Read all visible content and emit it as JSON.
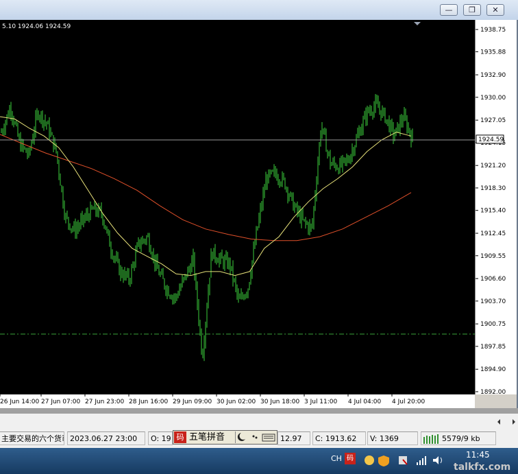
{
  "window": {
    "minimize_glyph": "—",
    "restore_glyph": "❐",
    "close_glyph": "✕"
  },
  "ohlc_text": "5.10 1924.06 1924.59",
  "current_price": "1924.59",
  "price_ticks": [
    "1938.75",
    "1935.88",
    "1932.90",
    "1930.00",
    "1927.05",
    "1924.15",
    "1921.20",
    "1918.30",
    "1915.40",
    "1912.45",
    "1909.55",
    "1906.60",
    "1903.70",
    "1900.75",
    "1897.85",
    "1894.90",
    "1892.00"
  ],
  "time_ticks": [
    "26 Jun 14:00",
    "27 Jun 07:00",
    "27 Jun 23:00",
    "28 Jun 16:00",
    "29 Jun 09:00",
    "30 Jun 02:00",
    "30 Jun 18:00",
    "3 Jul 11:00",
    "4 Jul 04:00",
    "4 Jul 20:00"
  ],
  "chart_data": {
    "type": "candlestick",
    "x_tick_labels": [
      "26 Jun 14:00",
      "27 Jun 07:00",
      "27 Jun 23:00",
      "28 Jun 16:00",
      "29 Jun 09:00",
      "30 Jun 02:00",
      "30 Jun 18:00",
      "3 Jul 11:00",
      "4 Jul 04:00",
      "4 Jul 20:00"
    ],
    "y_tick_labels": [
      "1938.75",
      "1935.88",
      "1932.90",
      "1930.00",
      "1927.05",
      "1924.15",
      "1921.20",
      "1918.30",
      "1915.40",
      "1912.45",
      "1909.55",
      "1906.60",
      "1903.70",
      "1900.75",
      "1897.85",
      "1894.90",
      "1892.00"
    ],
    "ylim": [
      1892.0,
      1938.75
    ],
    "close_path": [
      1925.5,
      1928.8,
      1924.0,
      1922.5,
      1928.2,
      1926.5,
      1923.0,
      1914.5,
      1912.8,
      1914.2,
      1915.5,
      1915.0,
      1910.5,
      1907.5,
      1906.5,
      1911.0,
      1912.0,
      1908.0,
      1905.5,
      1904.0,
      1906.5,
      1909.0,
      1896.5,
      1910.0,
      1909.0,
      1908.5,
      1903.5,
      1905.5,
      1913.0,
      1919.5,
      1920.2,
      1919.0,
      1916.0,
      1914.0,
      1913.0,
      1926.5,
      1921.5,
      1921.0,
      1922.0,
      1925.0,
      1928.0,
      1929.0,
      1927.5,
      1925.0,
      1927.5,
      1924.6
    ],
    "ma_fast": [
      1927.5,
      1927.2,
      1926.0,
      1925.0,
      1923.5,
      1921.0,
      1918.0,
      1915.0,
      1912.5,
      1910.5,
      1909.5,
      1908.5,
      1907.2,
      1907.0,
      1907.5,
      1907.5,
      1907.0,
      1907.5,
      1910.5,
      1912.0,
      1914.5,
      1916.5,
      1918.2,
      1919.5,
      1921.0,
      1923.0,
      1924.5,
      1925.5,
      1925.0
    ],
    "ma_slow": [
      1925.2,
      1924.0,
      1922.8,
      1921.8,
      1920.8,
      1919.5,
      1918.0,
      1916.0,
      1914.2,
      1913.0,
      1912.3,
      1911.7,
      1911.5,
      1911.5,
      1912.0,
      1913.0,
      1914.5,
      1916.0,
      1917.7
    ]
  },
  "status_bar": {
    "text1": "主要交易的六个货币",
    "datetime": "2023.06.27 23:00",
    "open": "O: 19",
    "high": "12.97",
    "close": "C: 1913.62",
    "volume": "V: 1369",
    "traffic": "5579/9 kb"
  },
  "ime": {
    "logo": "码",
    "label": "五笔拼音"
  },
  "taskbar": {
    "lang": "CH",
    "clock": "11:45",
    "watermark": "talkfx.com"
  }
}
